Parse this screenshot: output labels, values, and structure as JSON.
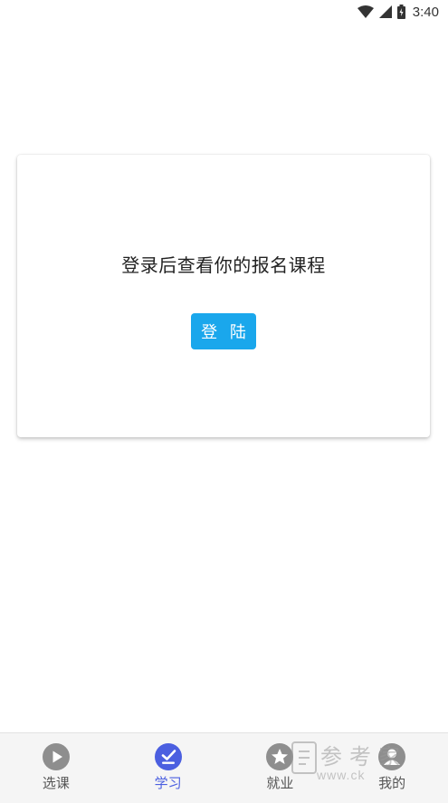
{
  "status_bar": {
    "time": "3:40",
    "icons": [
      "wifi-icon",
      "signal-icon",
      "battery-icon"
    ]
  },
  "card": {
    "message": "登录后查看你的报名课程",
    "login_button": "登 陆"
  },
  "tabbar": {
    "active_color": "#4b5fe0",
    "inactive_color": "#555555",
    "items": [
      {
        "label": "选课",
        "icon": "play-icon",
        "active": false
      },
      {
        "label": "学习",
        "icon": "check-icon",
        "active": true
      },
      {
        "label": "就业",
        "icon": "star-icon",
        "active": false
      },
      {
        "label": "我的",
        "icon": "user-icon",
        "active": false
      }
    ]
  },
  "watermark": {
    "text": "参考家",
    "url": "www.ck"
  },
  "colors": {
    "primary_button": "#1aa7ec",
    "tab_active": "#4b5fe0"
  }
}
